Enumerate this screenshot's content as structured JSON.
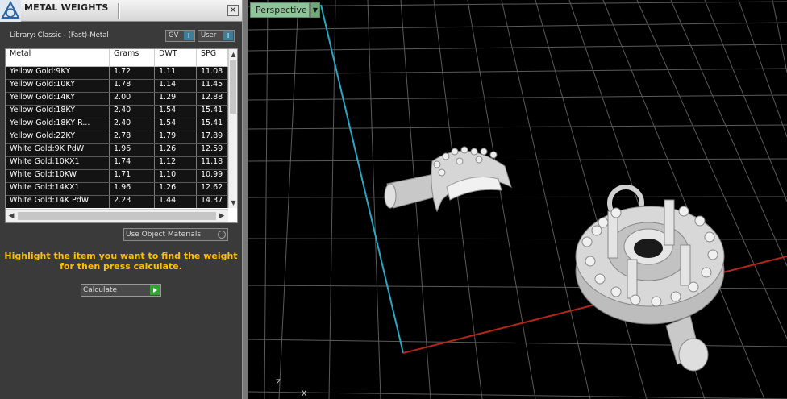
{
  "panel": {
    "title": "METAL WEIGHTS",
    "close_label": "✕",
    "library_label": "Library: Classic - (Fast)-Metal",
    "gv_label": "GV",
    "user_label": "User",
    "toggle_glyph": "I"
  },
  "table": {
    "headers": [
      "Metal",
      "Grams",
      "DWT",
      "SPG"
    ],
    "rows": [
      [
        "Yellow Gold:9KY",
        "1.72",
        "1.11",
        "11.08"
      ],
      [
        "Yellow Gold:10KY",
        "1.78",
        "1.14",
        "11.45"
      ],
      [
        "Yellow Gold:14KY",
        "2.00",
        "1.29",
        "12.88"
      ],
      [
        "Yellow Gold:18KY",
        "2.40",
        "1.54",
        "15.41"
      ],
      [
        "Yellow Gold:18KY R...",
        "2.40",
        "1.54",
        "15.41"
      ],
      [
        "Yellow Gold:22KY",
        "2.78",
        "1.79",
        "17.89"
      ],
      [
        "White Gold:9K PdW",
        "1.96",
        "1.26",
        "12.59"
      ],
      [
        "White Gold:10KX1",
        "1.74",
        "1.12",
        "11.18"
      ],
      [
        "White Gold:10KW",
        "1.71",
        "1.10",
        "10.99"
      ],
      [
        "White Gold:14KX1",
        "1.96",
        "1.26",
        "12.62"
      ],
      [
        "White Gold:14K PdW",
        "2.23",
        "1.44",
        "14.37"
      ]
    ]
  },
  "options": {
    "use_object_materials": "Use Object Materials"
  },
  "instructions": {
    "line1": "Highlight the item you want to find the weight",
    "line2": "for then press calculate."
  },
  "calculate_label": "Calculate",
  "viewport": {
    "view_name": "Perspective",
    "axis_z": "Z",
    "axis_x": "X"
  },
  "colors": {
    "instruction_text": "#ffc000",
    "viewport_tab": "#8fc49b",
    "toggle_on": "#3b7f9a",
    "calc_go": "#2fa52f",
    "axis_red": "#b3261e",
    "axis_cyan": "#29a7c4"
  }
}
